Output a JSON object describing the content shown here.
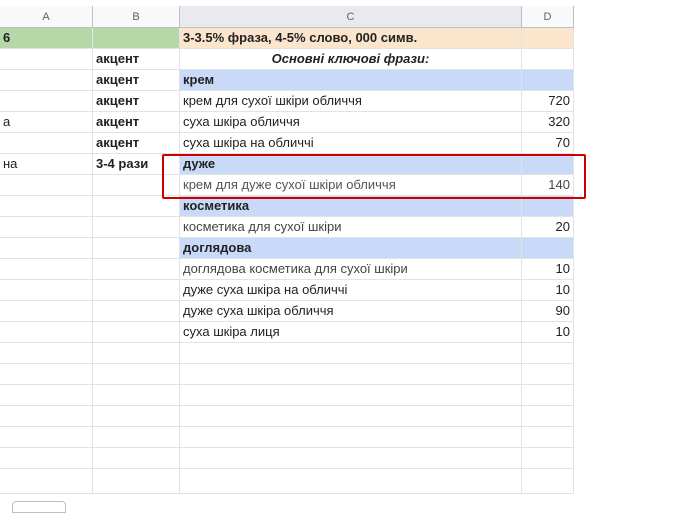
{
  "columns": [
    "A",
    "B",
    "C",
    "D"
  ],
  "rows": [
    {
      "a": "6",
      "b": "",
      "c": "3-3.5% фраза, 4-5% слово, 000 симв.",
      "d": ""
    },
    {
      "a": "",
      "b": "акцент",
      "c": "Основні ключові фрази:",
      "d": ""
    },
    {
      "a": "",
      "b": "акцент",
      "c": "крем",
      "d": ""
    },
    {
      "a": "",
      "b": "акцент",
      "c": "крем для сухої шкіри обличчя",
      "d": "720"
    },
    {
      "a": "а",
      "b": "акцент",
      "c": "суха шкіра обличчя",
      "d": "320"
    },
    {
      "a": "",
      "b": "акцент",
      "c": "суха шкіра на обличчі",
      "d": "70"
    },
    {
      "a": "на",
      "b": "3-4 рази",
      "c": "дуже",
      "d": ""
    },
    {
      "a": "",
      "b": "",
      "c": "крем для дуже сухої шкіри обличчя",
      "d": "140"
    },
    {
      "a": "",
      "b": "",
      "c": "косметика",
      "d": ""
    },
    {
      "a": "",
      "b": "",
      "c": "косметика для сухої шкіри",
      "d": "20"
    },
    {
      "a": "",
      "b": "",
      "c": "доглядова",
      "d": ""
    },
    {
      "a": "",
      "b": "",
      "c": "доглядова косметика для сухої шкіри",
      "d": "10"
    },
    {
      "a": "",
      "b": "",
      "c": "дуже суха шкіра на обличчі",
      "d": "10"
    },
    {
      "a": "",
      "b": "",
      "c": "дуже суха шкіра обличчя",
      "d": "90"
    },
    {
      "a": "",
      "b": "",
      "c": "суха шкіра лиця",
      "d": "10"
    }
  ],
  "colors": {
    "header_green": "#b6d7a8",
    "header_orange": "#fce5cd",
    "group_blue": "#c9daf8",
    "highlight_red": "#cc0000"
  }
}
